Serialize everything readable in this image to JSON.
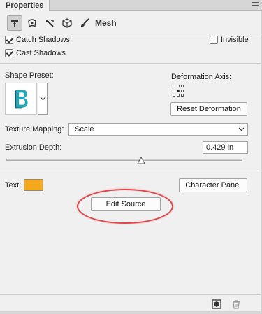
{
  "panel": {
    "tab_title": "Properties",
    "menu_icon": "panel-menu-icon"
  },
  "toolbar": {
    "tools": [
      {
        "name": "mesh-tool-icon",
        "active": true
      },
      {
        "name": "deform-tool-icon",
        "active": false
      },
      {
        "name": "cap-tool-icon",
        "active": false
      },
      {
        "name": "coordinates-tool-icon",
        "active": false
      },
      {
        "name": "brush-tool-icon",
        "active": false
      }
    ],
    "mesh_label": "Mesh"
  },
  "options": {
    "catch_shadows": {
      "label": "Catch Shadows",
      "checked": true
    },
    "cast_shadows": {
      "label": "Cast Shadows",
      "checked": true
    },
    "invisible": {
      "label": "Invisible",
      "checked": false
    }
  },
  "shape": {
    "preset_label": "Shape Preset:",
    "deformation_axis_label": "Deformation Axis:",
    "reset_button": "Reset Deformation"
  },
  "texture": {
    "label": "Texture Mapping:",
    "value": "Scale"
  },
  "extrusion": {
    "label": "Extrusion Depth:",
    "value": "0.429 in",
    "slider_fraction": 0.57
  },
  "text": {
    "label": "Text:",
    "color": "#f5a81e",
    "character_panel_button": "Character Panel",
    "edit_source_button": "Edit Source"
  },
  "colors": {
    "highlight": "#e0474c",
    "preset_icon": "#1fa8b8"
  }
}
